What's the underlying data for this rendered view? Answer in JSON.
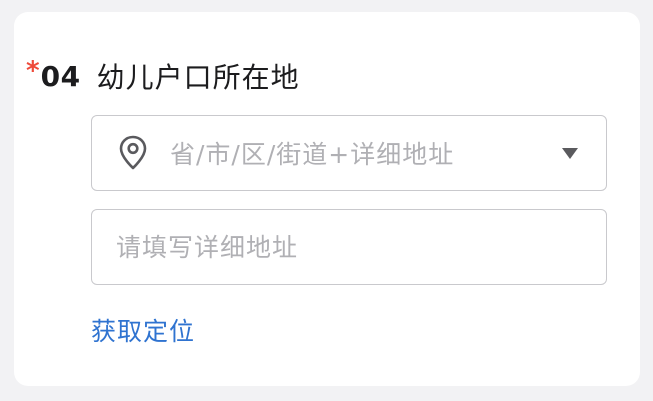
{
  "question": {
    "required_mark": "*",
    "number": "04",
    "title": "幼儿户口所在地"
  },
  "region_select": {
    "icon": "location-pin-icon",
    "placeholder": "省/市/区/街道+详细地址",
    "caret_icon": "triangle-down-icon"
  },
  "detail_address": {
    "value": "",
    "placeholder": "请填写详细地址"
  },
  "locate": {
    "label": "获取定位"
  },
  "colors": {
    "required": "#ee4a3a",
    "link": "#2f73d0",
    "placeholder": "#b0b0b4",
    "border": "#c9c9cd",
    "background": "#f2f2f4"
  }
}
